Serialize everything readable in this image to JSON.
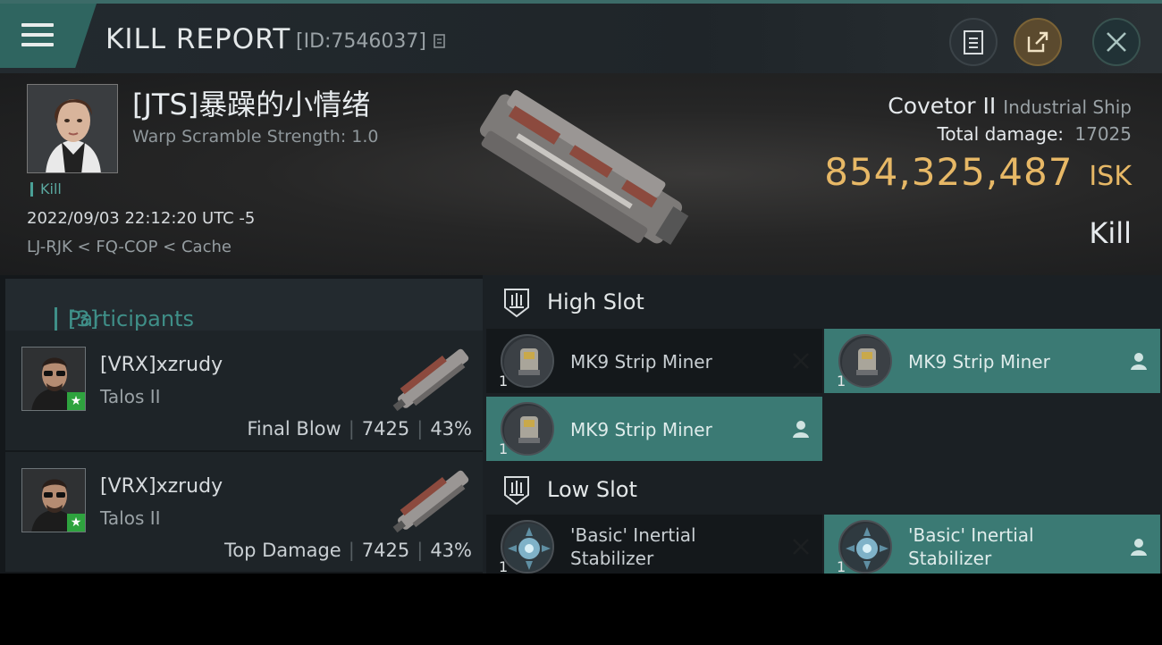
{
  "header": {
    "title": "KILL REPORT",
    "report_id": "[ID:7546037]",
    "buttons": [
      "clipboard-icon",
      "share-icon",
      "close-icon"
    ]
  },
  "victim": {
    "name": "[JTS]暴躁的小情绪",
    "warp_scramble": "Warp Scramble Strength: 1.0",
    "tag": "Kill",
    "datetime": "2022/09/03 22:12:20 UTC -5",
    "location": "LJ-RJK < FQ-COP < Cache"
  },
  "ship": {
    "name": "Covetor II",
    "class": "Industrial Ship",
    "total_damage_label": "Total damage:",
    "total_damage": "17025",
    "isk_value": "854,325,487",
    "isk_unit": "ISK",
    "result": "Kill"
  },
  "participants": {
    "title": "Participants",
    "count": "[3]",
    "items": [
      {
        "name": "[VRX]xzrudy",
        "ship": "Talos II",
        "role": "Final Blow",
        "damage": "7425",
        "percent": "43%"
      },
      {
        "name": "[VRX]xzrudy",
        "ship": "Talos II",
        "role": "Top Damage",
        "damage": "7425",
        "percent": "43%"
      }
    ]
  },
  "slots": {
    "high": {
      "title": "High Slot",
      "modules": [
        {
          "name": "MK9 Strip Miner",
          "qty": "1",
          "status": "destroyed"
        },
        {
          "name": "MK9 Strip Miner",
          "qty": "1",
          "status": "dropped"
        },
        {
          "name": "MK9 Strip Miner",
          "qty": "1",
          "status": "dropped"
        }
      ]
    },
    "low": {
      "title": "Low Slot",
      "modules": [
        {
          "name_line1": "'Basic' Inertial",
          "name_line2": "Stabilizer",
          "qty": "1",
          "status": "destroyed"
        },
        {
          "name_line1": "'Basic' Inertial",
          "name_line2": "Stabilizer",
          "qty": "1",
          "status": "dropped"
        }
      ]
    }
  },
  "colors": {
    "accent_teal": "#3b7a74",
    "isk_gold": "#e7b866"
  }
}
